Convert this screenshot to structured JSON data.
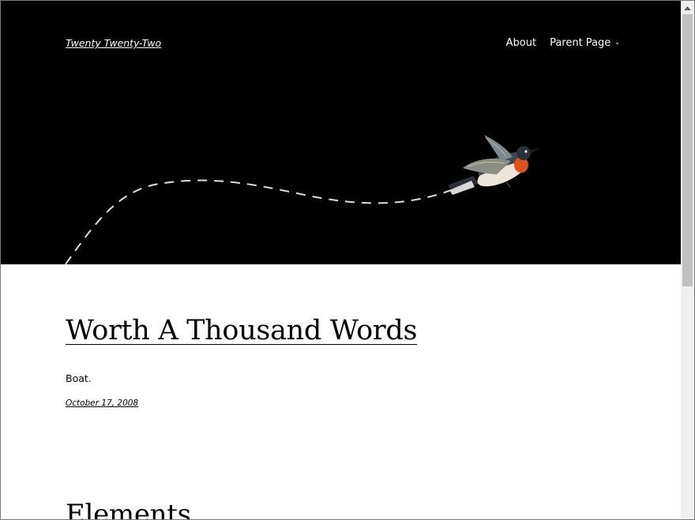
{
  "site": {
    "title": "Twenty Twenty-Two"
  },
  "nav": {
    "items": [
      {
        "label": "About"
      },
      {
        "label": "Parent Page",
        "has_submenu": true
      }
    ]
  },
  "icons": {
    "submenu": "chevron-down-icon",
    "header_art": "bird-flight-path-illustration",
    "scroll_up": "scroll-up-arrow-icon"
  },
  "post": {
    "title": "Worth A Thousand Words",
    "excerpt": "Boat.",
    "date": "October 17, 2008"
  },
  "next_section": {
    "title": "Elements"
  },
  "colors": {
    "header_bg": "#000000",
    "header_text": "#ffffff",
    "body_bg": "#ffffff",
    "text": "#000000",
    "dash_path": "#e7ddcd"
  }
}
